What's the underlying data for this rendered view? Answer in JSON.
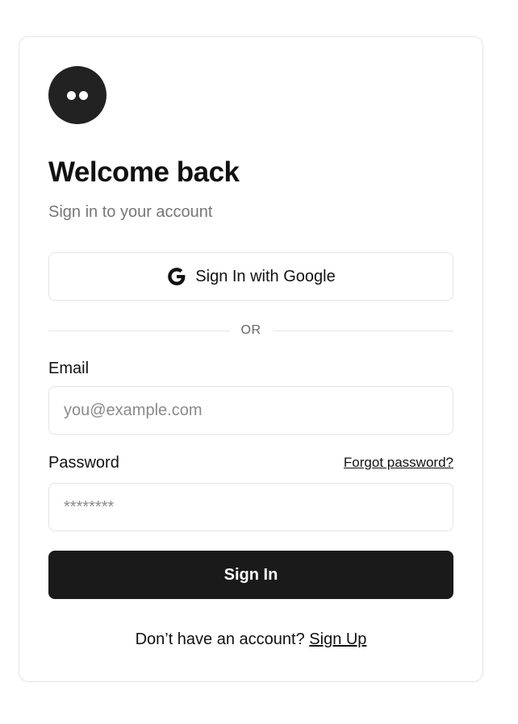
{
  "logo": {
    "icon": "two-dots-logo-icon"
  },
  "header": {
    "title": "Welcome back",
    "subtitle": "Sign in to your account"
  },
  "google": {
    "icon": "google-g-icon",
    "label": "Sign In with Google"
  },
  "divider": {
    "text": "OR"
  },
  "form": {
    "email_label": "Email",
    "email_placeholder": "you@example.com",
    "email_value": "",
    "password_label": "Password",
    "password_placeholder": "********",
    "password_value": "",
    "forgot_label": "Forgot password?",
    "submit_label": "Sign In"
  },
  "footer": {
    "prompt": "Don’t have an account?",
    "link_label": "Sign Up"
  },
  "colors": {
    "primary_button": "#1a1a1a",
    "border": "#e4e4e7",
    "muted_text": "#777777"
  }
}
